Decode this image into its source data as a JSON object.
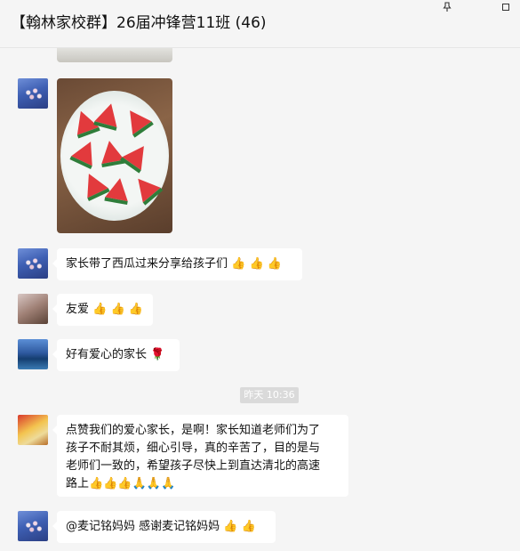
{
  "window": {
    "title": "【翰林家校群】26届冲锋营11班 (46)",
    "pin_icon": "pin-icon",
    "maximize_icon": "maximize-icon"
  },
  "messages": [
    {
      "type": "image",
      "description_icon": "watermelon-photo"
    },
    {
      "type": "text",
      "text": "家长带了西瓜过来分享给孩子们",
      "emoji": [
        "thumbs-up",
        "thumbs-up",
        "thumbs-up"
      ]
    },
    {
      "type": "text",
      "text": "友爱",
      "emoji": [
        "thumbs-up",
        "thumbs-up",
        "thumbs-up"
      ]
    },
    {
      "type": "text",
      "text": "好有爱心的家长",
      "emoji": [
        "rose"
      ]
    },
    {
      "type": "text",
      "line1": "点赞我们的爱心家长，是啊！家长知道老师们为了",
      "line2": "孩子不耐其烦，细心引导，真的辛苦了，目的是与",
      "line3": "老师们一致的，希望孩子尽快上到直达清北的高速",
      "line4": "路上",
      "emoji": [
        "thumbs-up",
        "thumbs-up",
        "thumbs-up",
        "clap",
        "clap",
        "clap"
      ]
    },
    {
      "type": "text",
      "text": "@麦记铭妈妈 感谢麦记铭妈妈",
      "emoji": [
        "thumbs-up",
        "thumbs-up"
      ]
    }
  ],
  "timestamp": "昨天 10:36",
  "emoji_chars": {
    "thumbs_up": "👍",
    "clap": "🙏",
    "rose": "🌹"
  }
}
